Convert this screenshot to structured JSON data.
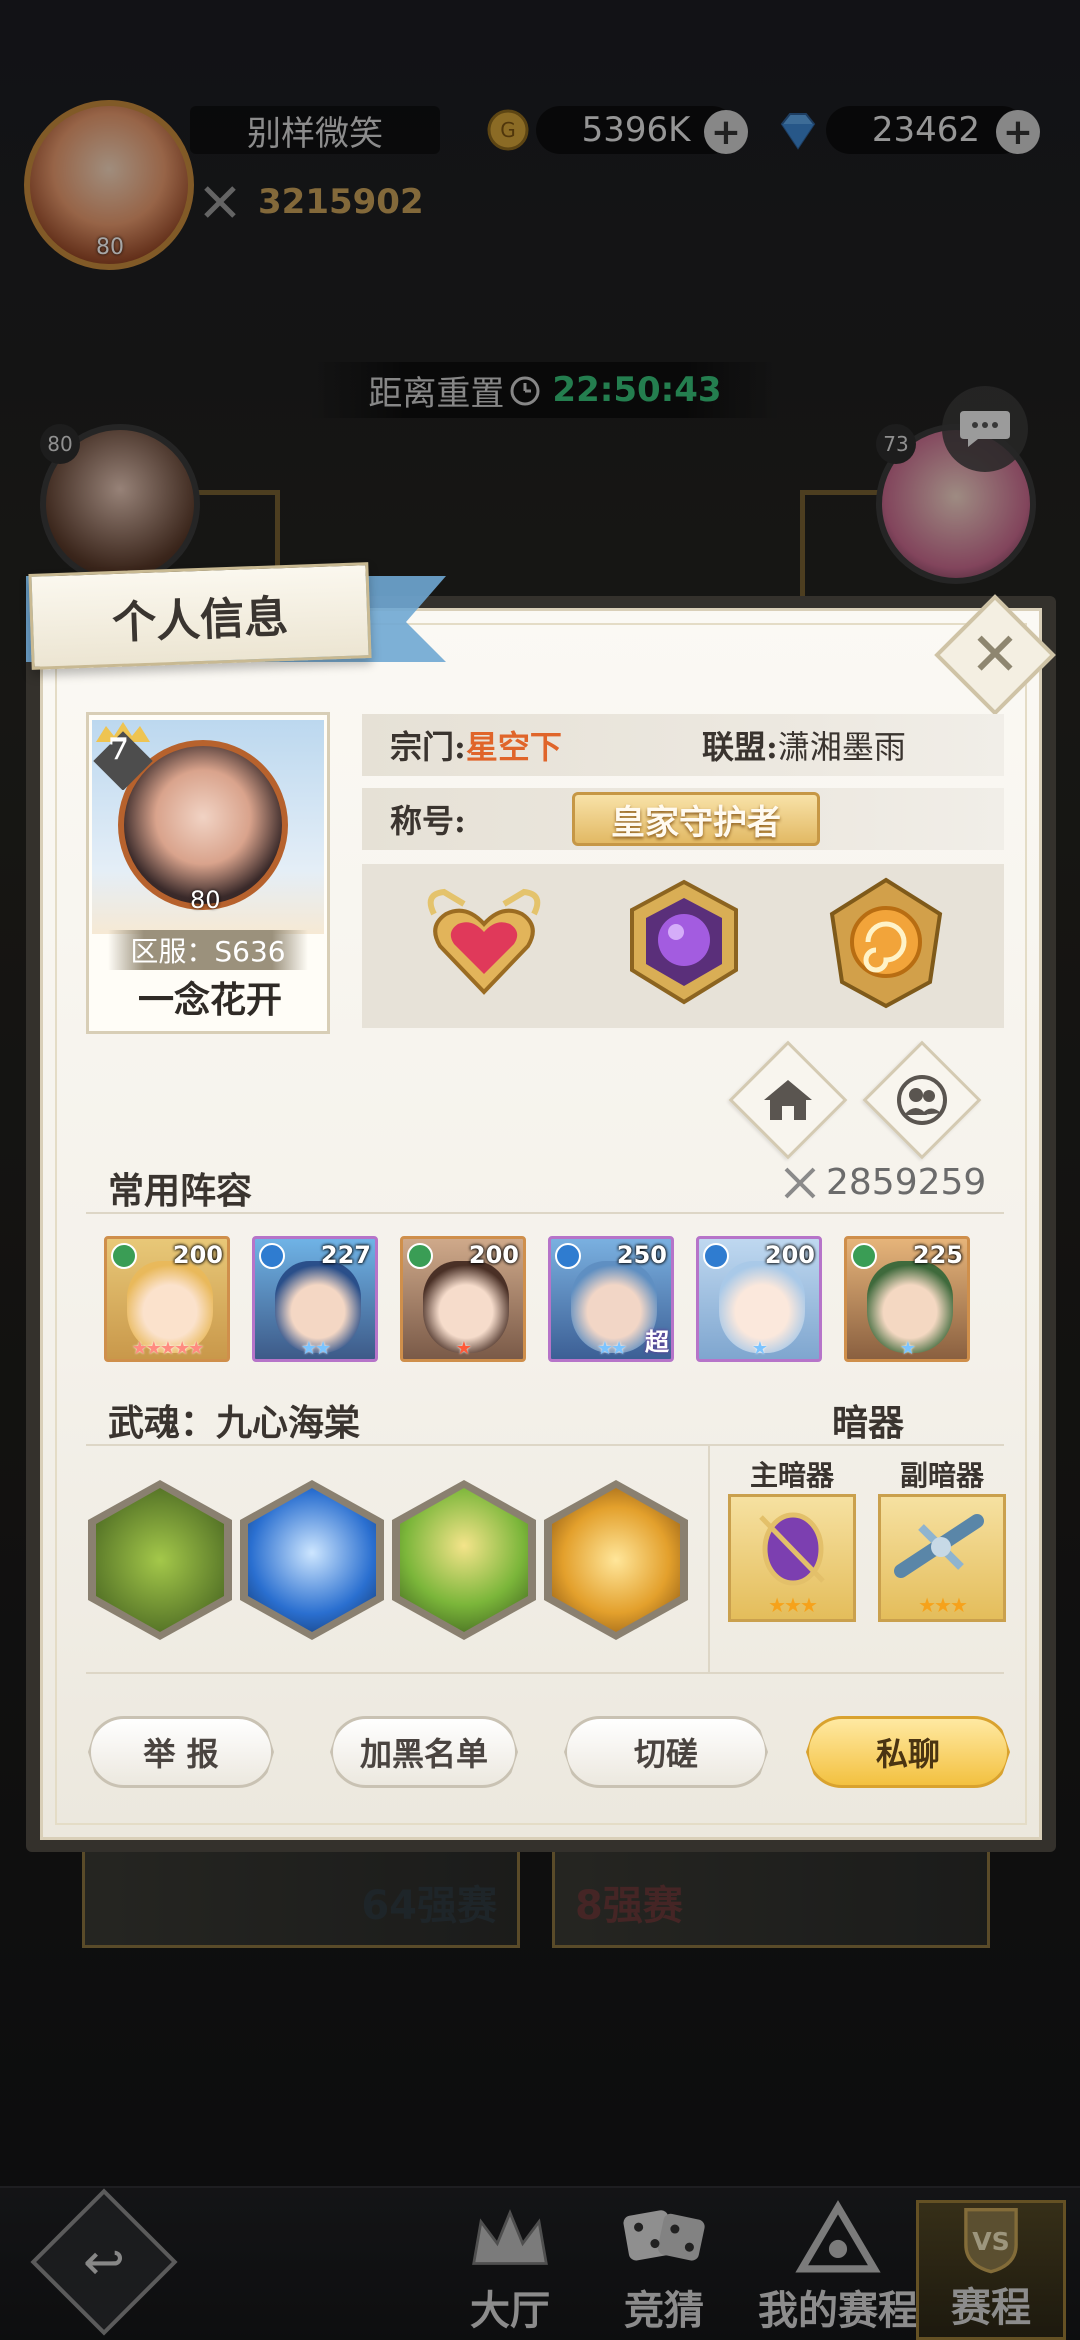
{
  "player": {
    "name": "别样微笑",
    "level": "80",
    "gold": "5396K",
    "diamonds": "23462",
    "power": "3215902"
  },
  "reset": {
    "label": "距离重置",
    "time": "22:50:43"
  },
  "bracket": {
    "left_level": "80",
    "right_level": "73",
    "stage_left": "64强赛",
    "stage_right": "8强赛"
  },
  "modal": {
    "title": "个人信息",
    "close_icon": "close-icon",
    "profile": {
      "vip": "7",
      "level": "80",
      "server": "区服：S636",
      "nickname": "一念花开"
    },
    "sect_label": "宗门:",
    "sect_value": "星空下",
    "alliance_label": "联盟:",
    "alliance_value": "潇湘墨雨",
    "title_label": "称号:",
    "title_value": "皇家守护者",
    "badges": [
      "heart-badge-icon",
      "purple-orb-badge-icon",
      "gold-spiral-badge-icon"
    ],
    "lineup_title": "常用阵容",
    "lineup_power": "2859259",
    "heroes": [
      {
        "level": "200",
        "element": "wind",
        "stars": "★★★★★",
        "star_color": "pink",
        "extra": ""
      },
      {
        "level": "227",
        "element": "water",
        "stars": "★★",
        "star_color": "blue",
        "extra": ""
      },
      {
        "level": "200",
        "element": "wind",
        "stars": "★",
        "star_color": "red",
        "extra": ""
      },
      {
        "level": "250",
        "element": "water",
        "stars": "★★",
        "star_color": "blue",
        "extra": "超"
      },
      {
        "level": "200",
        "element": "water",
        "stars": "★",
        "star_color": "blue",
        "extra": ""
      },
      {
        "level": "225",
        "element": "wind",
        "stars": "★",
        "star_color": "blue",
        "extra": ""
      }
    ],
    "soul_title": "武魂：九心海棠",
    "hidden_weapon_title": "暗器",
    "main_weapon_label": "主暗器",
    "sub_weapon_label": "副暗器",
    "main_weapon_stars": "★★★",
    "sub_weapon_stars": "★★★",
    "buttons": {
      "report": "举 报",
      "blacklist": "加黑名单",
      "duel": "切磋",
      "private_chat": "私聊"
    }
  },
  "nav": {
    "hall": "大厅",
    "guess": "竞猜",
    "my_schedule": "我的赛程",
    "schedule": "赛程"
  },
  "colors": {
    "accent_gold": "#f3c140",
    "sect_orange": "#e0652a",
    "timer_green": "#38c27a"
  }
}
